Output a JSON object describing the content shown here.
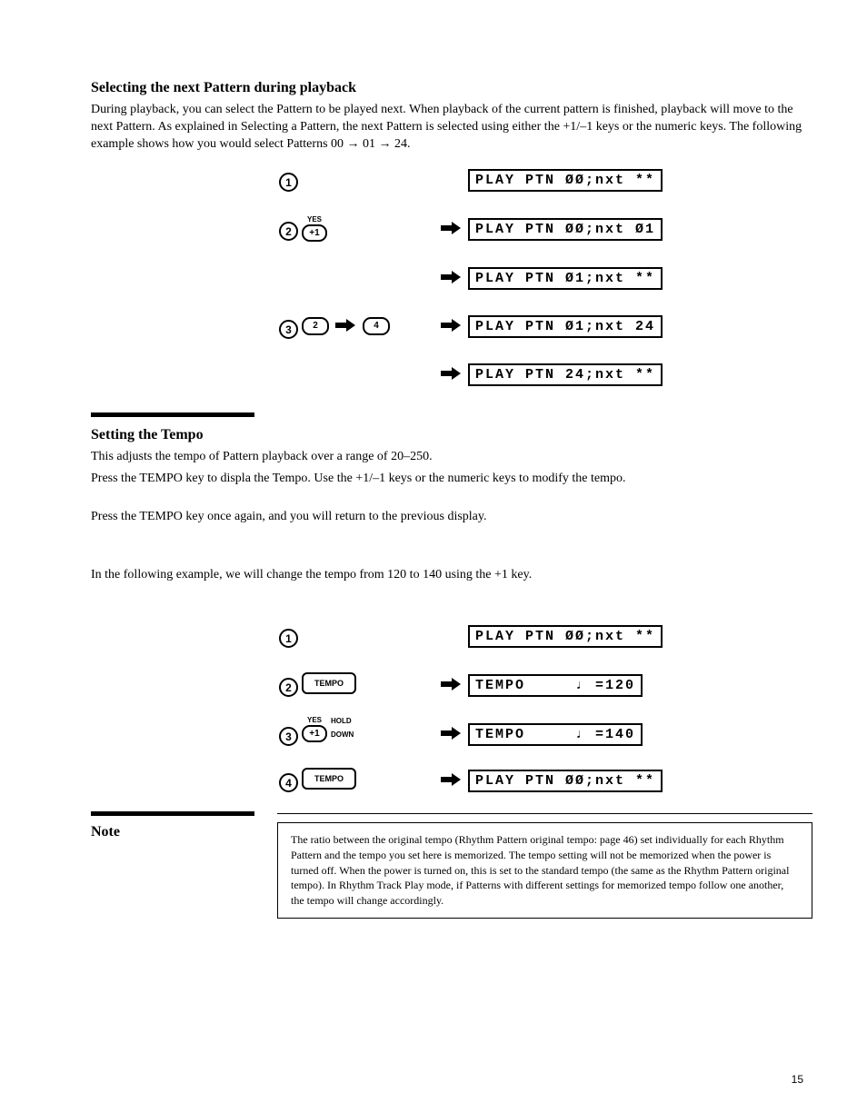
{
  "sec1": {
    "heading": "Selecting the next Pattern during playback",
    "para": "During playback, you can select the Pattern to be played next. When playback of the current pattern is finished, playback will move to the next Pattern. As explained in Selecting a Pattern, the next Pattern is selected using either the +1/–1 keys or the numeric keys. The following example shows how you would select Patterns 00 → 01 → 24."
  },
  "lcds": {
    "a": "PLAY PTN ØØ;nxt **",
    "b": "PLAY PTN ØØ;nxt Ø1",
    "c": "PLAY PTN Ø1;nxt **",
    "d": "PLAY PTN Ø1;nxt 24",
    "e": "PLAY PTN 24;nxt **"
  },
  "keys": {
    "plus1": "+1",
    "plus1_top": "YES",
    "k2": "2",
    "k4": "4",
    "tempo": "TEMPO",
    "hold": "HOLD",
    "down": "DOWN"
  },
  "sec2": {
    "heading": "Setting the Tempo",
    "p1": "This adjusts the tempo of Pattern playback over a range of 20–250.",
    "p2": "Press the TEMPO key to displa the Tempo. Use the +1/–1 keys or the numeric keys to modify the tempo.",
    "p3": "Press the TEMPO key once again, and you will return to the previous display.",
    "p4": "In the following example, we will change the tempo from 120 to 140 using the +1 key."
  },
  "lcds2": {
    "a": "PLAY PTN ØØ;nxt **",
    "b": "TEMPO     ♩ =120",
    "c": "TEMPO     ♩ =140",
    "d": "PLAY PTN ØØ;nxt **"
  },
  "sec3": {
    "heading": "Note",
    "note": "The ratio between the original tempo (Rhythm Pattern original tempo: page 46) set individually for each Rhythm Pattern and the tempo you set here is memorized. The tempo setting will not be memorized when the power is turned off. When the power is turned on, this is set to the standard tempo (the same as the Rhythm Pattern original tempo). In Rhythm Track Play mode, if Patterns with different settings for memorized tempo follow one another, the tempo will change accordingly."
  },
  "page_no": "15"
}
